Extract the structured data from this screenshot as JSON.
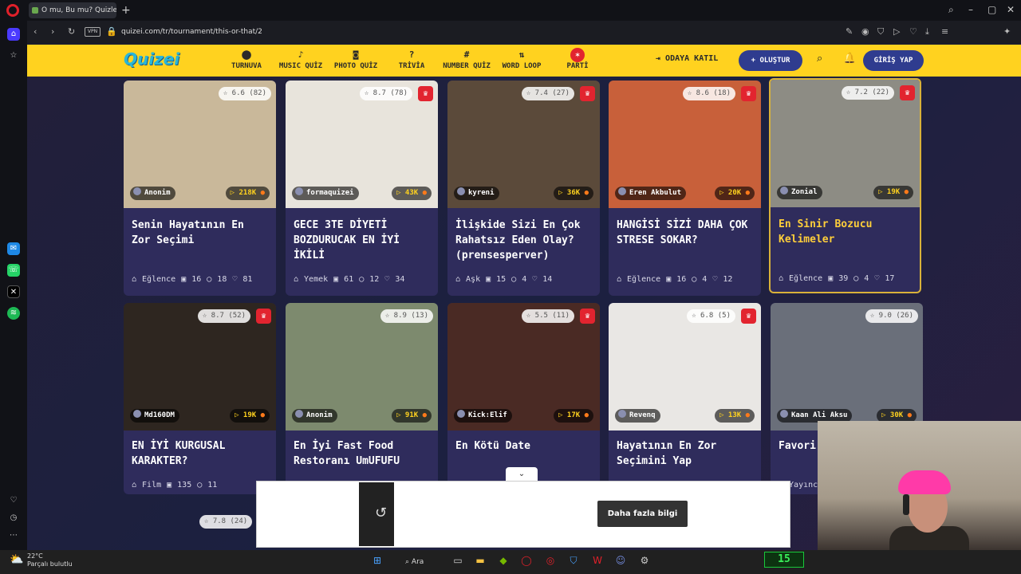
{
  "browser": {
    "tab_title": "O mu, Bu mu? Quizleri | T",
    "url": "quizei.com/tr/tournament/this-or-that/2",
    "vpn": "VPN"
  },
  "header": {
    "logo": "Quizei",
    "nav": [
      {
        "label": "TURNUVA",
        "icon": "tournament-icon"
      },
      {
        "label": "MUSIC QUİZ",
        "icon": "music-icon"
      },
      {
        "label": "PHOTO QUİZ",
        "icon": "camera-icon"
      },
      {
        "label": "TRİVİA",
        "icon": "trivia-icon"
      },
      {
        "label": "NUMBER QUİZ",
        "icon": "hash-icon"
      },
      {
        "label": "WORD LOOP",
        "icon": "loop-icon"
      },
      {
        "label": "PARTİ",
        "icon": "party-icon"
      }
    ],
    "join_room": "ODAYA KATIL",
    "create": "+ OLUŞTUR",
    "login": "GİRİŞ YAP"
  },
  "cards": [
    {
      "rating": "☆ 6.6 (82)",
      "crown": false,
      "author": "Anonim",
      "plays": "▷ 218K",
      "title": "Senin Hayatının En Zor Seçimi",
      "category": "Eğlence",
      "count": "16",
      "comments": "18",
      "likes": "81",
      "bg": "#c9b89a"
    },
    {
      "rating": "☆ 8.7 (78)",
      "crown": true,
      "author": "formaquizei",
      "plays": "▷ 43K",
      "title": "GECE 3TE DİYETİ BOZDURUCAK EN İYİ İKİLİ",
      "category": "Yemek",
      "count": "61",
      "comments": "12",
      "likes": "34",
      "bg": "#e8e4dc"
    },
    {
      "rating": "☆ 7.4 (27)",
      "crown": true,
      "author": "kyreni",
      "plays": "▷ 36K",
      "title": "İlişkide Sizi En Çok Rahatsız Eden Olay? (prensesperver)",
      "category": "Aşk",
      "count": "15",
      "comments": "4",
      "likes": "14",
      "bg": "#5b4a3a"
    },
    {
      "rating": "☆ 8.6 (18)",
      "crown": true,
      "author": "Eren Akbulut",
      "plays": "▷ 20K",
      "title": "HANGİSİ SİZİ DAHA ÇOK STRESE SOKAR?",
      "category": "Eğlence",
      "count": "16",
      "comments": "4",
      "likes": "12",
      "bg": "#c8603a"
    },
    {
      "rating": "☆ 7.2 (22)",
      "crown": true,
      "author": "Zonial",
      "plays": "▷ 19K",
      "title": "En Sinir Bozucu Kelimeler",
      "category": "Eğlence",
      "count": "39",
      "comments": "4",
      "likes": "17",
      "bg": "#8d8c84"
    },
    {
      "rating": "☆ 8.7 (52)",
      "crown": true,
      "author": "Md160DM",
      "plays": "▷ 19K",
      "title": "EN İYİ KURGUSAL KARAKTER?",
      "category": "Film",
      "count": "135",
      "comments": "11",
      "likes": "",
      "bg": "#2e2620"
    },
    {
      "rating": "☆ 8.9 (13)",
      "crown": false,
      "author": "Anonim",
      "plays": "▷ 91K",
      "title": "En İyi Fast Food Restoranı UmUFUFU",
      "category": "",
      "count": "",
      "comments": "",
      "likes": "",
      "bg": "#7d8a6e"
    },
    {
      "rating": "☆ 5.5 (11)",
      "crown": true,
      "author": "Kick:Elif",
      "plays": "▷ 17K",
      "title": "En Kötü Date",
      "category": "",
      "count": "",
      "comments": "",
      "likes": "",
      "bg": "#4a2a24"
    },
    {
      "rating": "☆ 6.8 (5)",
      "crown": true,
      "author": "Revenq",
      "plays": "▷ 13K",
      "title": "Hayatının En Zor Seçimini Yap",
      "category": "",
      "count": "",
      "comments": "",
      "likes": "",
      "bg": "#e9e7e4"
    },
    {
      "rating": "☆ 9.0 (26)",
      "crown": false,
      "author": "Kaan Ali Aksu",
      "plays": "▷ 30K",
      "title": "Favori Karakt",
      "category": "Yayıncı",
      "count": "",
      "comments": "",
      "likes": "",
      "bg": "#6a6f7a"
    }
  ],
  "bottom_rating": "☆ 7.8 (24)",
  "ad": {
    "button": "Daha fazla bilgi"
  },
  "taskbar": {
    "temp": "22°C",
    "weather": "Parçalı bulutlu",
    "search": "Ara",
    "score": "15"
  }
}
